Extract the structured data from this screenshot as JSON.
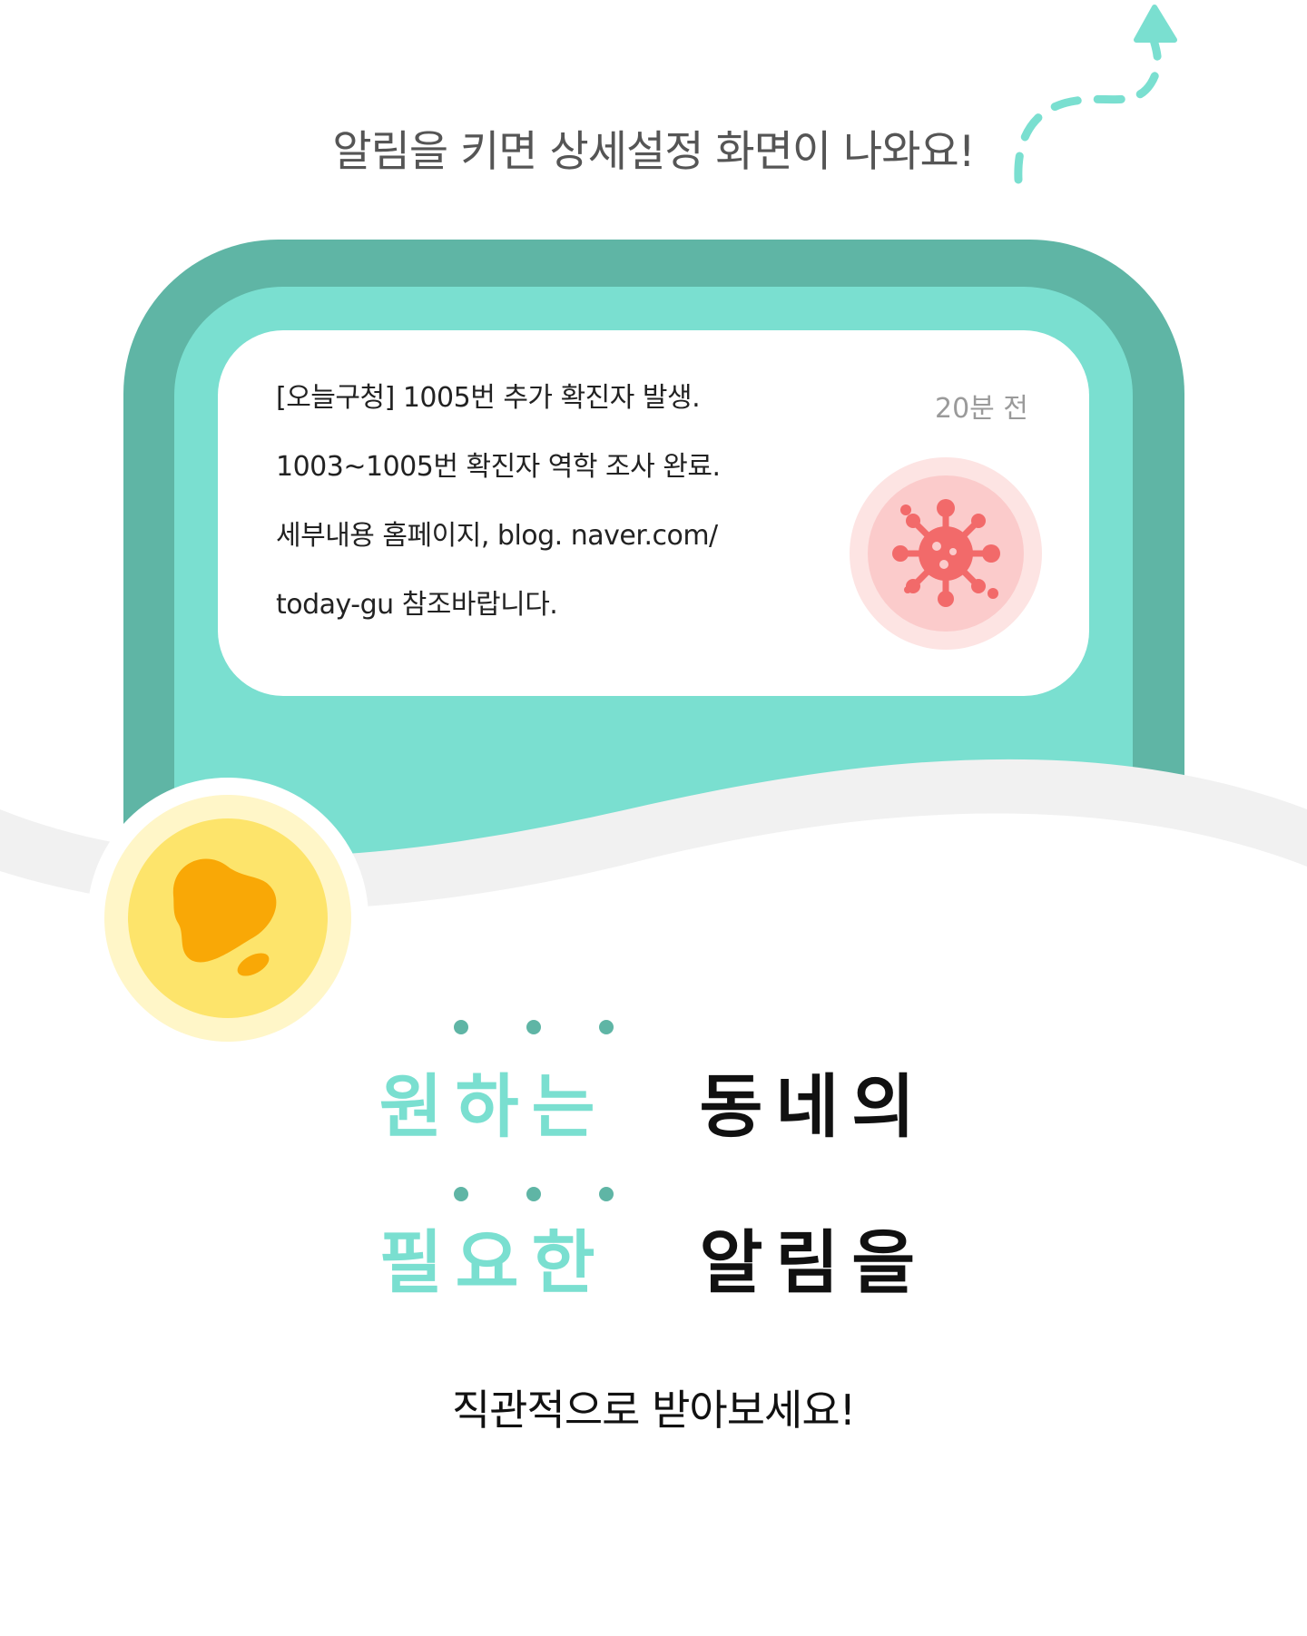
{
  "top_caption": "알림을 키면 상세설정 화면이 나와요!",
  "notification": {
    "lines": [
      "[오늘구청] 1005번 추가 확진자 발생.",
      "1003~1005번 확진자 역학 조사 완료.",
      "세부내용 홈페이지, blog. naver.com/",
      "today-gu 참조바랍니다."
    ],
    "time": "20분 전",
    "icon": "virus-icon"
  },
  "bell_icon": "bell-icon",
  "headline": {
    "row1_accent": "원하는",
    "row1_dark": "동네의",
    "row2_accent": "필요한",
    "row2_dark": "알림을"
  },
  "sub_caption": "직관적으로 받아보세요!",
  "colors": {
    "teal_dark": "#5fb5a5",
    "teal_light": "#7adfd0",
    "wave_gray": "#f1f1f1",
    "bell_yellow": "#fde46b",
    "bell_orange": "#f9a806",
    "virus_red": "#f26a6a"
  }
}
